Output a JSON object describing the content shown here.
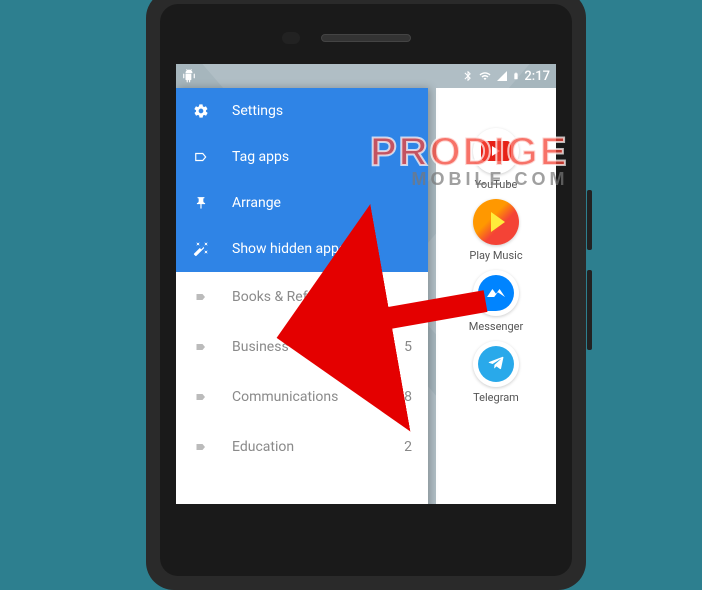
{
  "statusbar": {
    "time": "2:17"
  },
  "drawer": {
    "menu": [
      {
        "icon": "gear-icon",
        "label": "Settings"
      },
      {
        "icon": "tag-outline-icon",
        "label": "Tag apps"
      },
      {
        "icon": "pin-icon",
        "label": "Arrange"
      },
      {
        "icon": "wand-icon",
        "label": "Show hidden apps"
      }
    ],
    "categories": [
      {
        "label": "Books & Reference",
        "count": ""
      },
      {
        "label": "Business",
        "count": "5"
      },
      {
        "label": "Communications",
        "count": "18"
      },
      {
        "label": "Education",
        "count": "2"
      }
    ]
  },
  "apps": [
    {
      "label": "YouTube",
      "icon": "youtube"
    },
    {
      "label": "Play Music",
      "icon": "playmusic"
    },
    {
      "label": "Messenger",
      "icon": "messenger"
    },
    {
      "label": "Telegram",
      "icon": "telegram"
    }
  ],
  "watermark": {
    "line1": "PRODIGE",
    "line2": "MOBILE.COM"
  }
}
